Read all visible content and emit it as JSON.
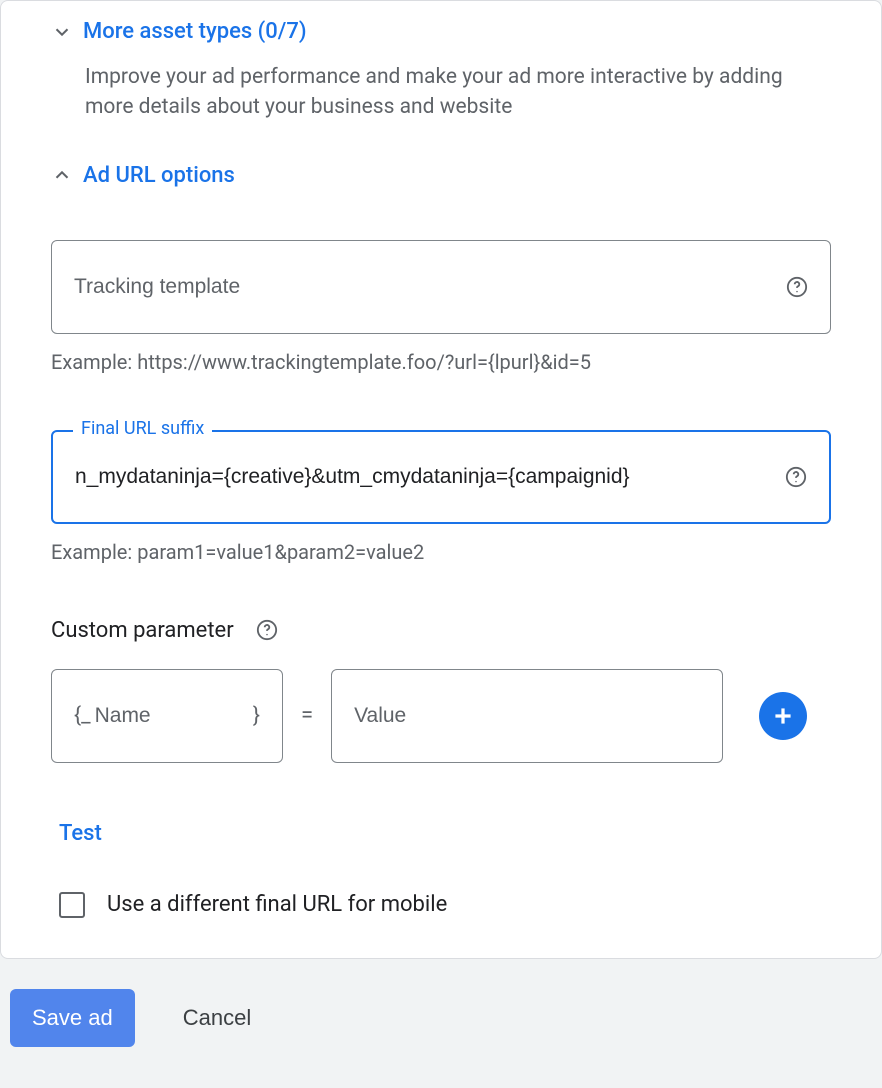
{
  "moreAssets": {
    "label": "More asset types (0/7)",
    "description": "Improve your ad performance and make your ad more interactive by adding more details about your business and website"
  },
  "urlOptions": {
    "label": "Ad URL options",
    "tracking": {
      "placeholder": "Tracking template",
      "example": "Example: https://www.trackingtemplate.foo/?url={lpurl}&id=5"
    },
    "suffix": {
      "label": "Final URL suffix",
      "value": "n_mydataninja={creative}&utm_cmydataninja={campaignid}",
      "example": "Example: param1=value1&param2=value2"
    },
    "customParam": {
      "header": "Custom parameter",
      "braceOpen": "{_",
      "namePlaceholder": "Name",
      "braceClose": "}",
      "equals": "=",
      "valuePlaceholder": "Value"
    },
    "testLabel": "Test",
    "mobileLabel": "Use a different final URL for mobile"
  },
  "footer": {
    "save": "Save ad",
    "cancel": "Cancel"
  }
}
